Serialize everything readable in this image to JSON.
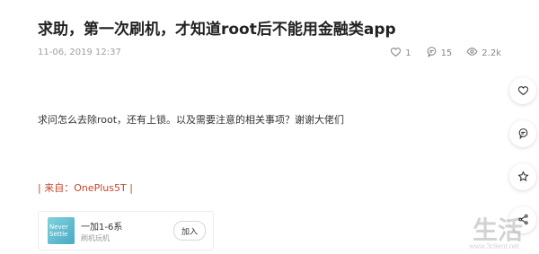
{
  "post": {
    "title": "求助，第一次刷机，才知道root后不能用金融类app",
    "date": "11-06, 2019 12:37",
    "body": "求问怎么去除root，还有上锁。以及需要注意的相关事项？谢谢大佬们",
    "source": "| 来自：OnePlus5T |"
  },
  "stats": {
    "likes": "1",
    "comments": "15",
    "views": "2.2k"
  },
  "group_card": {
    "logo_line1": "Never",
    "logo_line2": "Settle",
    "name": "一加1-6系",
    "category": "刷机玩机",
    "join_label": "加入"
  },
  "rail": {
    "icons": [
      "heart-icon",
      "comment-icon",
      "star-icon",
      "share-icon"
    ]
  },
  "watermark": {
    "text": "生活",
    "url": "www.3client.net"
  },
  "colors": {
    "source_text": "#c7442c",
    "meta_text": "#a0a0a0"
  }
}
